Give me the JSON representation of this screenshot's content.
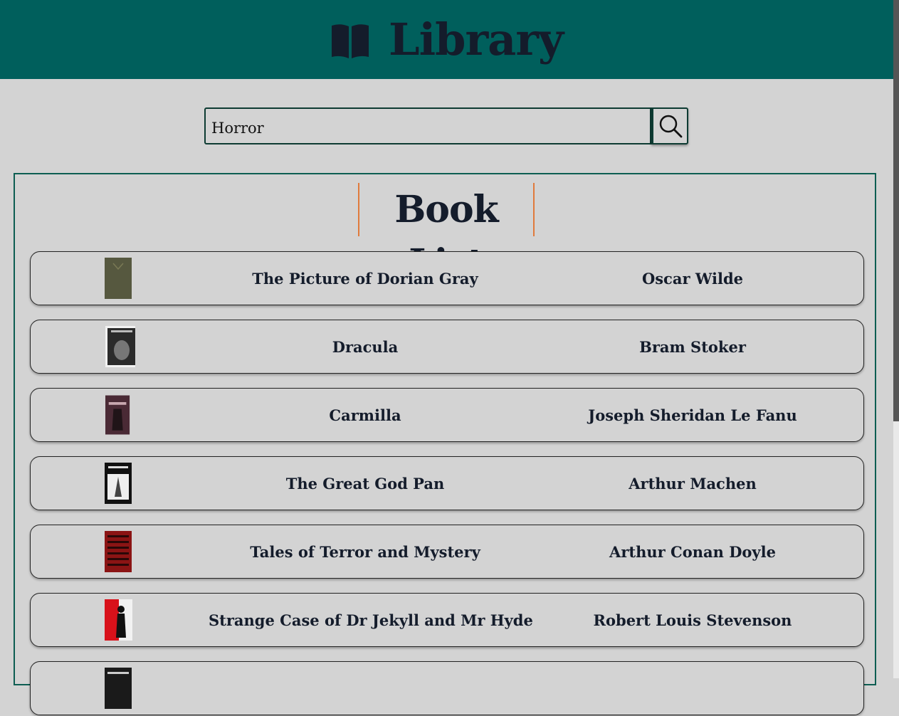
{
  "header": {
    "title": "Library",
    "icon": "book-icon"
  },
  "search": {
    "value": "Horror",
    "placeholder": "",
    "button_icon": "search-icon"
  },
  "book_list": {
    "heading": "Book List",
    "books": [
      {
        "title": "The Picture of Dorian Gray",
        "author": "Oscar Wilde",
        "cover_color": "#56583f"
      },
      {
        "title": "Dracula",
        "author": "Bram Stoker",
        "cover_color": "#2b2b2b"
      },
      {
        "title": "Carmilla",
        "author": "Joseph Sheridan Le Fanu",
        "cover_color": "#4a2a35"
      },
      {
        "title": "The Great God Pan",
        "author": "Arthur Machen",
        "cover_color": "#111111"
      },
      {
        "title": "Tales of Terror and Mystery",
        "author": "Arthur Conan Doyle",
        "cover_color": "#8b1414"
      },
      {
        "title": "Strange Case of Dr Jekyll and Mr Hyde",
        "author": "Robert Louis Stevenson",
        "cover_color": "#d8111a"
      },
      {
        "title": "",
        "author": "",
        "cover_color": "#1a1a1a"
      }
    ]
  },
  "colors": {
    "header_bg": "#005f5c",
    "accent": "#e07a3c",
    "page_bg": "#d3d3d3",
    "text": "#141c2b"
  }
}
